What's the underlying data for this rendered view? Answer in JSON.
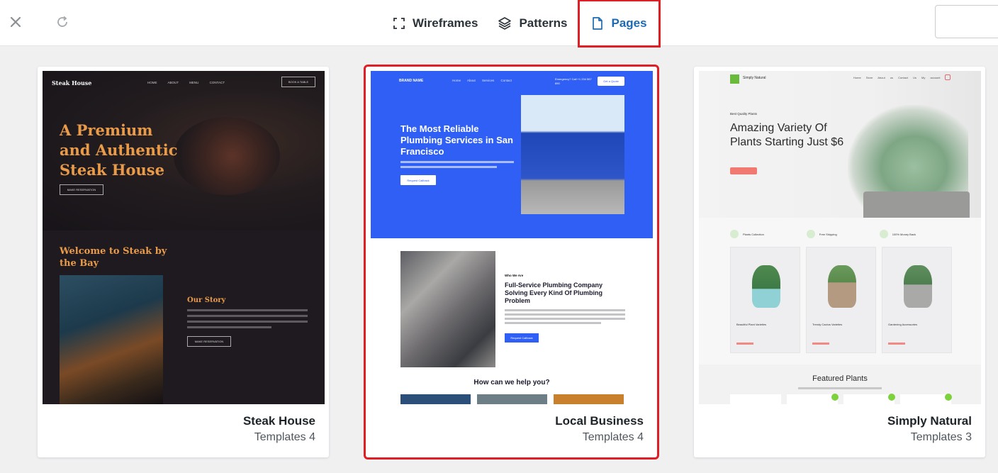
{
  "toolbar": {
    "close_icon": "close-icon",
    "refresh_icon": "refresh-icon",
    "tabs": [
      {
        "label": "Wireframes",
        "icon": "frame-corners-icon",
        "active": false
      },
      {
        "label": "Patterns",
        "icon": "layers-icon",
        "active": false
      },
      {
        "label": "Pages",
        "icon": "page-icon",
        "active": true
      }
    ],
    "accent_color": "#1e6ab0",
    "highlight_color": "#e01e26"
  },
  "cards": [
    {
      "title": "Steak House",
      "subtitle": "Templates 4",
      "selected": false,
      "preview": {
        "logo": "Steak House",
        "nav": "HOME ABOUT MENU CONTACT",
        "nav_button": "BOOK A TABLE",
        "headline": "A Premium and Authentic Steak House",
        "hero_button": "MAKE RESERVATION",
        "section_title": "Welcome to Steak by the Bay",
        "story_title": "Our Story",
        "story_button": "MAKE RESERVATION"
      }
    },
    {
      "title": "Local Business",
      "subtitle": "Templates 4",
      "selected": true,
      "preview": {
        "brand": "BRAND NAME",
        "nav": "Home About Services Contact",
        "emergency": "Emergency? Call +1 234 567 890",
        "quote_button": "Get a Quote",
        "headline": "The Most Reliable Plumbing Services in San Francisco",
        "hero_button": "Request Callback",
        "who_label": "Who We Are",
        "section_title": "Full-Service Plumbing Company Solving Every Kind Of Plumbing Problem",
        "section_button": "Request Callback",
        "help_title": "How can we help you?"
      }
    },
    {
      "title": "Simply Natural",
      "subtitle": "Templates 3",
      "selected": false,
      "preview": {
        "logo": "Simply Natural",
        "nav": "Home Store About us Contact Us My account",
        "eyebrow": "Best Quality Plants",
        "headline": "Amazing Variety Of Plants Starting Just $6",
        "features": [
          "Plants Collection",
          "Free Shipping",
          "100% Money Back"
        ],
        "products": [
          "Beautiful Plant Varieties",
          "Trendy Cactus Varieties",
          "Gardening Accessories"
        ],
        "featured_title": "Featured Plants"
      }
    }
  ]
}
